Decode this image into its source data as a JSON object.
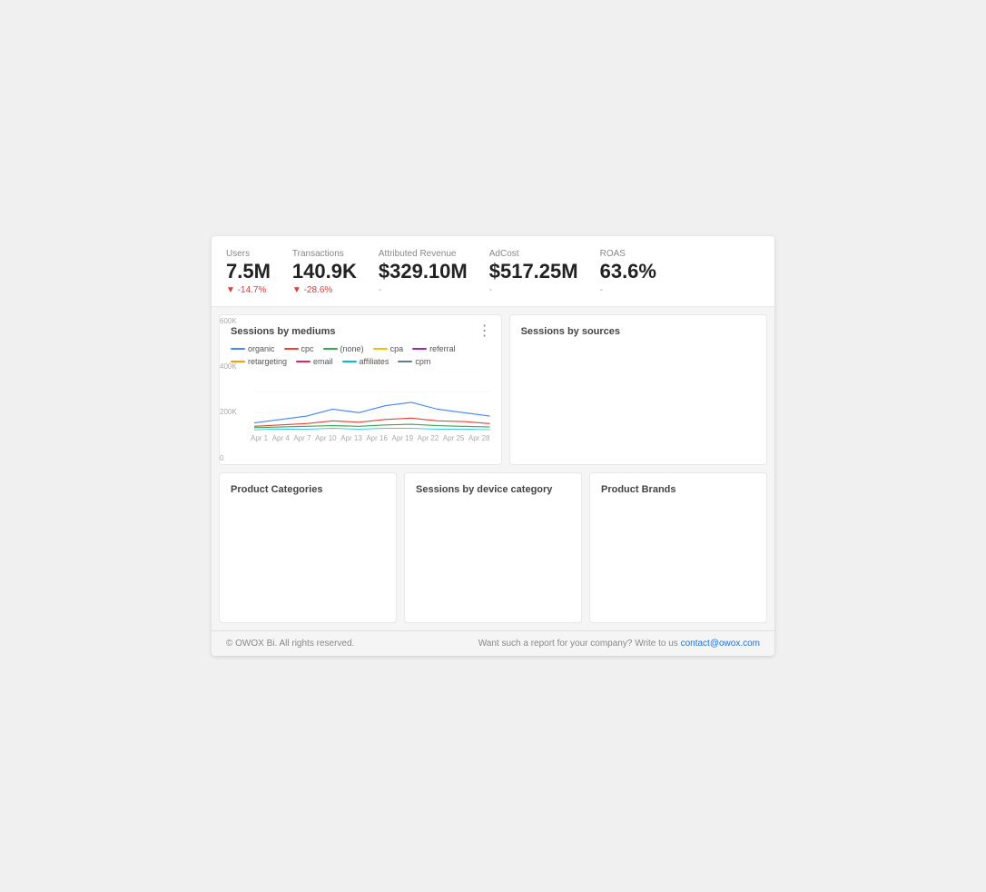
{
  "kpis": [
    {
      "label": "Users",
      "value": "7.5M",
      "change": "▼ -14.7%",
      "change_type": "negative"
    },
    {
      "label": "Transactions",
      "value": "140.9K",
      "change": "▼ -28.6%",
      "change_type": "negative"
    },
    {
      "label": "Attributed Revenue",
      "value": "$329.10M",
      "change": "-",
      "change_type": "neutral"
    },
    {
      "label": "AdCost",
      "value": "$517.25M",
      "change": "-",
      "change_type": "neutral"
    },
    {
      "label": "ROAS",
      "value": "63.6%",
      "change": "-",
      "change_type": "neutral"
    }
  ],
  "sessions_by_mediums": {
    "title": "Sessions by mediums",
    "legend": [
      {
        "label": "organic",
        "color": "#4285f4"
      },
      {
        "label": "cpc",
        "color": "#ea4335"
      },
      {
        "label": "(none)",
        "color": "#34a853"
      },
      {
        "label": "cpa",
        "color": "#fbbc04"
      },
      {
        "label": "referral",
        "color": "#9c27b0"
      },
      {
        "label": "retargeting",
        "color": "#ff9800"
      },
      {
        "label": "email",
        "color": "#e91e63"
      },
      {
        "label": "affiliates",
        "color": "#00bcd4"
      },
      {
        "label": "cpm",
        "color": "#607d8b"
      }
    ],
    "y_labels": [
      "600K",
      "400K",
      "200K",
      "0"
    ],
    "x_labels": [
      "Apr 1",
      "Apr 4",
      "Apr 7",
      "Apr 10",
      "Apr 13",
      "Apr 16",
      "Apr 19",
      "Apr 22",
      "Apr 25",
      "Apr 28"
    ]
  },
  "sessions_by_sources": {
    "title": "Sessions by sources"
  },
  "product_categories": {
    "title": "Product Categories"
  },
  "sessions_device_category": {
    "title": "Sessions by device category"
  },
  "product_brands": {
    "title": "Product Brands"
  },
  "footer": {
    "copyright": "© OWOX Bi. All rights reserved.",
    "cta_text": "Want such a report for your company? Write to us",
    "cta_link_text": "contact@owox.com",
    "cta_link_href": "mailto:contact@owox.com"
  }
}
